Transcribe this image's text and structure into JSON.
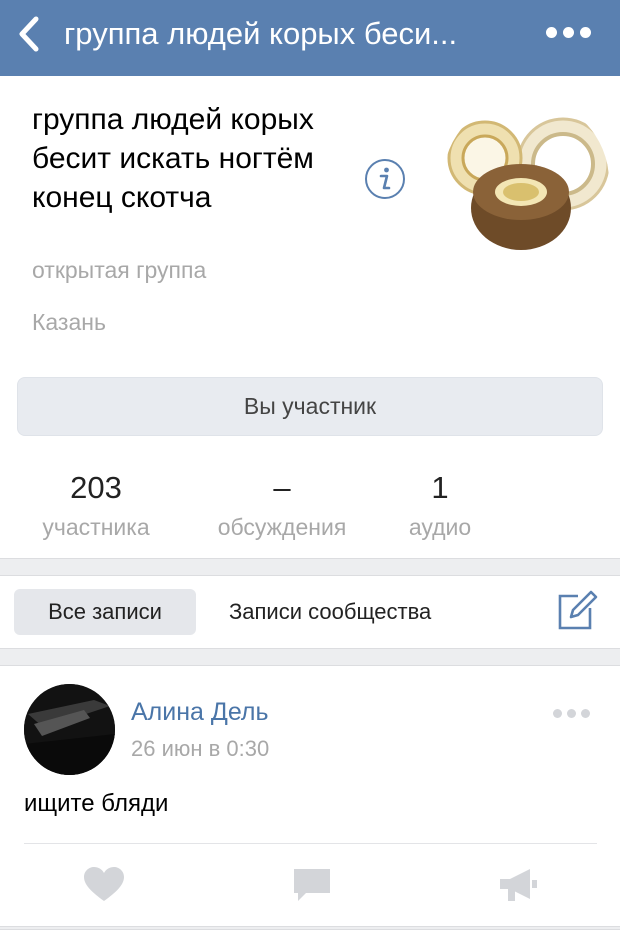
{
  "header": {
    "title": "группа людей корых беси...",
    "back_icon": "chevron-left-icon",
    "more_icon": "more-dots-icon",
    "bar_color": "#5a80b0"
  },
  "group": {
    "name": "группа людей корых бесит искать ногтём конец скотча",
    "type": "открытая группа",
    "city": "Казань",
    "info_icon": "info-icon",
    "avatar": "tape-rolls-avatar"
  },
  "membership": {
    "button_label": "Вы участник"
  },
  "stats": [
    {
      "value": "203",
      "label": "участника"
    },
    {
      "value": "–",
      "label": "обсуждения"
    },
    {
      "value": "1",
      "label": "аудио"
    }
  ],
  "wall_tabs": {
    "all": "Все записи",
    "community": "Записи сообщества",
    "edit_icon": "compose-icon"
  },
  "post": {
    "author": "Алина Дель",
    "time": "26 июн в 0:30",
    "text": "ищите бляди",
    "author_color": "#4a75a8",
    "actions": [
      "heart-icon",
      "comment-icon",
      "share-megaphone-icon"
    ]
  }
}
